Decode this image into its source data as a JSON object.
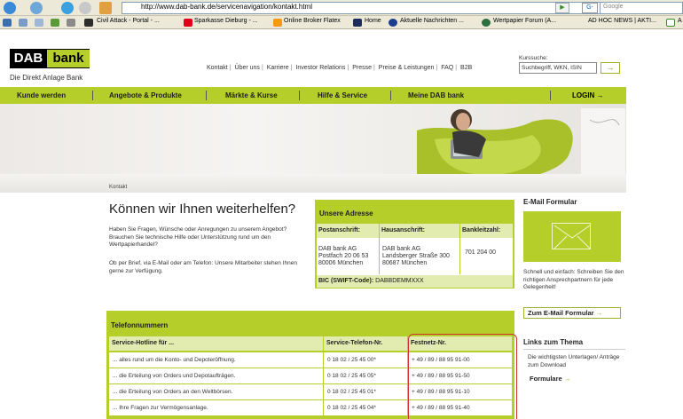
{
  "browser": {
    "url": "http://www.dab-bank.de/servicenavigation/kontakt.html",
    "search_placeholder": "Google",
    "search_engine_icon": "G-",
    "go_symbol": "▶",
    "bookmarks": [
      {
        "label": "Civil Attack - Portal - ...",
        "color": "#2d2d2d"
      },
      {
        "label": "Sparkasse Dieburg - ...",
        "color": "#e2001a"
      },
      {
        "label": "Online Broker Flatex",
        "color": "#f39c12"
      },
      {
        "label": "Home",
        "color": "#1c2c5c"
      },
      {
        "label": "Aktuelle Nachrichten ...",
        "color": "#1a3d8f"
      },
      {
        "label": "Wertpapier Forum (A...",
        "color": "#2c6e3f"
      },
      {
        "label": "AD HOC NEWS | AKTI...",
        "color": "#ffffff"
      },
      {
        "label": "A",
        "color": "#ffffff"
      }
    ]
  },
  "header": {
    "logo_left": "DAB",
    "logo_right": "bank",
    "tagline": "Die Direkt Anlage Bank",
    "top_links": [
      "Kontakt",
      "Über uns",
      "Karriere",
      "Investor Relations",
      "Presse",
      "Preise & Leistungen",
      "FAQ",
      "B2B"
    ],
    "kurssuche_label": "Kurssuche:",
    "kurssuche_value": "Suchbegriff, WKN, ISIN",
    "kurssuche_button": "→"
  },
  "mainnav": {
    "items": [
      "Kunde werden",
      "Angebote & Produkte",
      "Märkte & Kurse",
      "Hilfe & Service",
      "Meine DAB bank"
    ],
    "login": "LOGIN  →"
  },
  "breadcrumb": "Kontakt",
  "content": {
    "title": "Können wir Ihnen weiterhelfen?",
    "intro1": "Haben Sie Fragen, Wünsche oder Anregungen zu unserem Angebot? Brauchen Sie technische Hilfe oder Unterstützung rund um den Wertpapierhandel?",
    "intro2": "Ob per Brief, via E-Mail oder am Telefon: Unsere Mitarbeiter stehen Ihnen gerne zur Verfügung."
  },
  "address": {
    "title": "Unsere Adresse",
    "headers": [
      "Postanschrift:",
      "Hausanschrift:",
      "Bankleitzahl:"
    ],
    "post": [
      "DAB bank AG",
      "Postfach 20 06 53",
      "80006 München"
    ],
    "haus": [
      "DAB bank AG",
      "Landsberger Straße 300",
      "80687 München"
    ],
    "blz": "701 204 00",
    "bic_label": "BIC (SWIFT-Code):",
    "bic_value": "DABBDEMMXXX"
  },
  "email_formular": {
    "title": "E-Mail Formular",
    "text": "Schnell und einfach: Schreiben Sie den richtigen Ansprechpartnern für jede Gelegenheit!",
    "button": "Zum E-Mail Formular",
    "button_arrow": "→"
  },
  "links": {
    "title": "Links zum Thema",
    "text": "Die wichtigsten Unterlagen/ Anträge zum Download",
    "link": "Formulare",
    "link_arrow": "→"
  },
  "telefon": {
    "title": "Telefonnummern",
    "headers": [
      "Service-Hotline für ...",
      "Service-Telefon-Nr.",
      "Festnetz-Nr."
    ],
    "rows": [
      [
        "... alles rund um die Konto- und Depoteröffnung.",
        "0 18 02 / 25 45 00*",
        "+ 49 / 89 / 88 95 91-00"
      ],
      [
        "... die Erteilung von Orders und Depotaufträgen.",
        "0 18 02 / 25 45 05*",
        "+ 49 / 89 / 88 95 91-50"
      ],
      [
        "... die Erteilung von Orders an den Weltbörsen.",
        "0 18 02 / 25 45 01*",
        "+ 49 / 89 / 88 95 91-10"
      ],
      [
        "... Ihre Fragen zur Vermögensanlage.",
        "0 18 02 / 25 45 04*",
        "+ 49 / 89 / 88 95 91-40"
      ]
    ]
  }
}
